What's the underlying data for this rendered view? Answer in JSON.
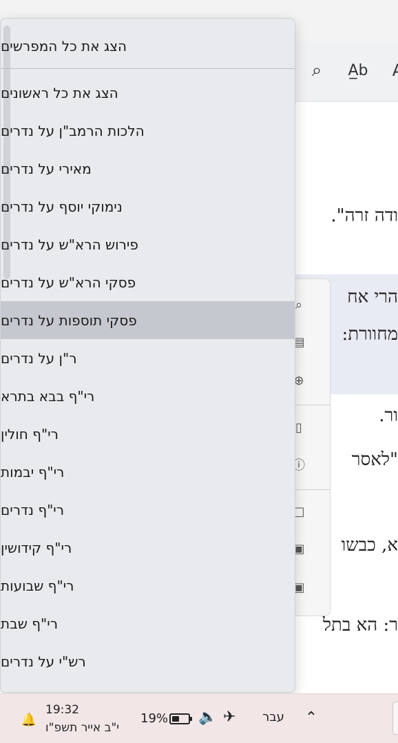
{
  "menu": {
    "items": [
      "הצג את כל המפרשים",
      "הצג את כל ראשונים",
      "הלכות הרמב\"ן על נדרים",
      "מאירי על נדרים",
      "נימוקי יוסף על נדרים",
      "פירוש הרא\"ש על נדרים",
      "פסקי הרא\"ש על נדרים",
      "פסקי תוספות על נדרים",
      "ר\"ן על נדרים",
      "רי\"ף בבא בתרא",
      "רי\"ף חולין",
      "רי\"ף יבמות",
      "רי\"ף נדרים",
      "רי\"ף קידושין",
      "רי\"ף שבועות",
      "רי\"ף שבת",
      "רש\"י על נדרים"
    ],
    "selected_index": 7
  },
  "document": {
    "lines": [
      "ודה זרה\".",
      "הרי אח",
      "מחוורת:",
      "ור.",
      "\"לאסר",
      "א, כבשו",
      "ר: הא בתל"
    ]
  },
  "toolbar": {
    "icons": [
      "search-icon",
      "spellcheck-icon",
      "font-icon"
    ]
  },
  "taskbar": {
    "language": "עבר",
    "battery_percent_label": "19%",
    "battery_level": 0.19,
    "time": "19:32",
    "date": "י\"ב אייר תשפ\"ו"
  },
  "colors": {
    "menu_bg": "#e8eaed",
    "menu_selected": "#c5c9cf",
    "taskbar_bg": "#f2e7e6"
  }
}
